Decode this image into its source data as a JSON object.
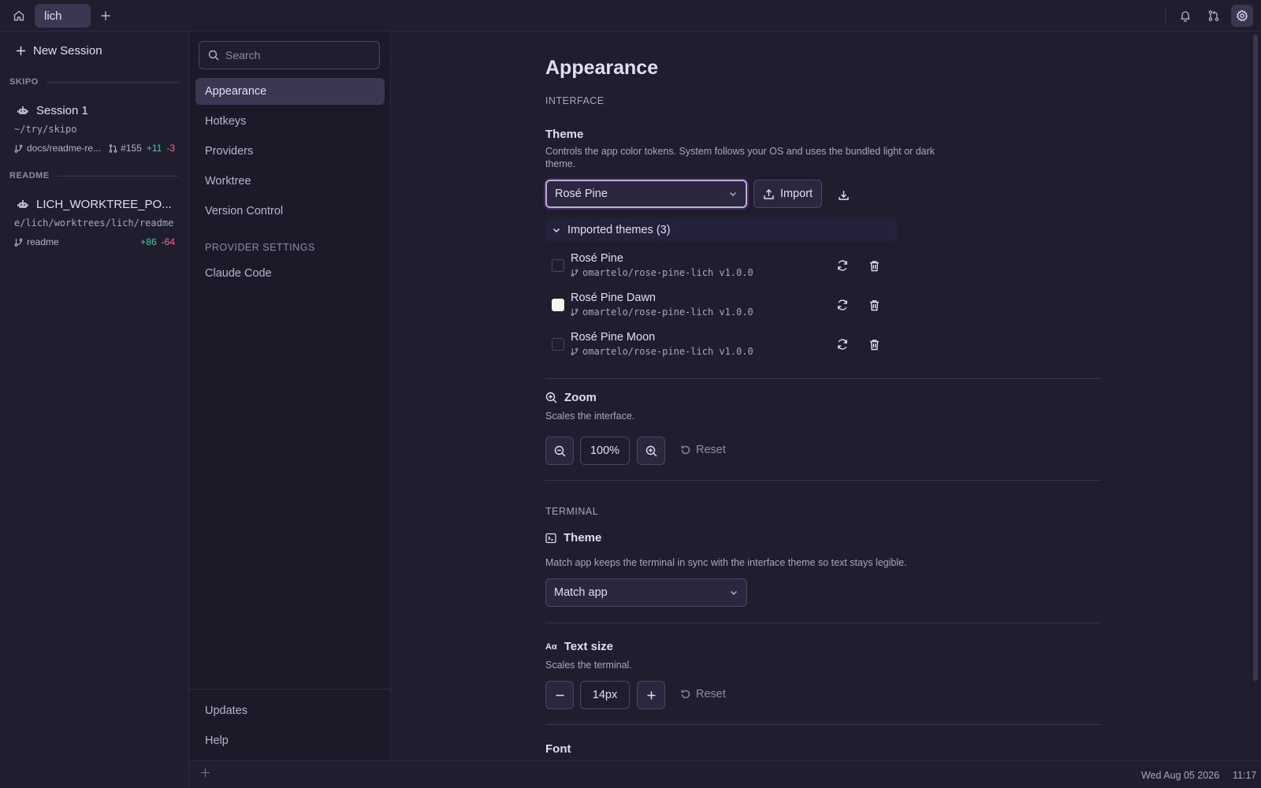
{
  "topbar": {
    "tab_label": "lich"
  },
  "sidebar": {
    "new_session_label": "New Session",
    "groups": [
      {
        "name": "SKIPO",
        "session": {
          "title": "Session 1",
          "path": "~/try/skipo",
          "branch": "docs/readme-re...",
          "pr": "#155",
          "additions": "+11",
          "deletions": "-3"
        }
      },
      {
        "name": "README",
        "session": {
          "title": "LICH_WORKTREE_PO...",
          "path": "e/lich/worktrees/lich/readme",
          "branch": "readme",
          "additions": "+86",
          "deletions": "-64"
        }
      }
    ]
  },
  "settings_nav": {
    "search_placeholder": "Search",
    "items": [
      "Appearance",
      "Hotkeys",
      "Providers",
      "Worktree",
      "Version Control"
    ],
    "provider_settings_header": "PROVIDER SETTINGS",
    "provider_items": [
      "Claude Code"
    ],
    "bottom_items": [
      "Updates",
      "Help"
    ]
  },
  "main": {
    "title": "Appearance",
    "interface_label": "INTERFACE",
    "theme": {
      "title": "Theme",
      "description": "Controls the app color tokens. System follows your OS and uses the bundled light or dark theme.",
      "selected": "Rosé Pine",
      "import_label": "Import"
    },
    "imported": {
      "header": "Imported themes (3)",
      "themes": [
        {
          "name": "Rosé Pine",
          "source": "omartelo/rose-pine-lich v1.0.0",
          "checked": false
        },
        {
          "name": "Rosé Pine Dawn",
          "source": "omartelo/rose-pine-lich v1.0.0",
          "checked": true
        },
        {
          "name": "Rosé Pine Moon",
          "source": "omartelo/rose-pine-lich v1.0.0",
          "checked": false
        }
      ]
    },
    "zoom": {
      "title": "Zoom",
      "description": "Scales the interface.",
      "value": "100%",
      "reset_label": "Reset"
    },
    "terminal_label": "TERMINAL",
    "terminal_theme": {
      "title": "Theme",
      "description": "Match app keeps the terminal in sync with the interface theme so text stays legible.",
      "selected": "Match app"
    },
    "text_size": {
      "icon_text": "Aα",
      "title": "Text size",
      "description": "Scales the terminal.",
      "value": "14px",
      "reset_label": "Reset"
    },
    "font": {
      "title": "Font"
    }
  },
  "statusbar": {
    "date": "Wed Aug 05 2026",
    "time": "11:17"
  },
  "colors": {
    "background": "#1f1d2e",
    "accent": "#c4a7e7",
    "additions": "#3ecfa0",
    "deletions": "#eb6f92"
  },
  "icons": {
    "home": "home-icon",
    "add_tab": "plus-icon",
    "notifications": "bell-icon",
    "source_control": "git-pull-request-icon",
    "settings": "gear-icon"
  }
}
